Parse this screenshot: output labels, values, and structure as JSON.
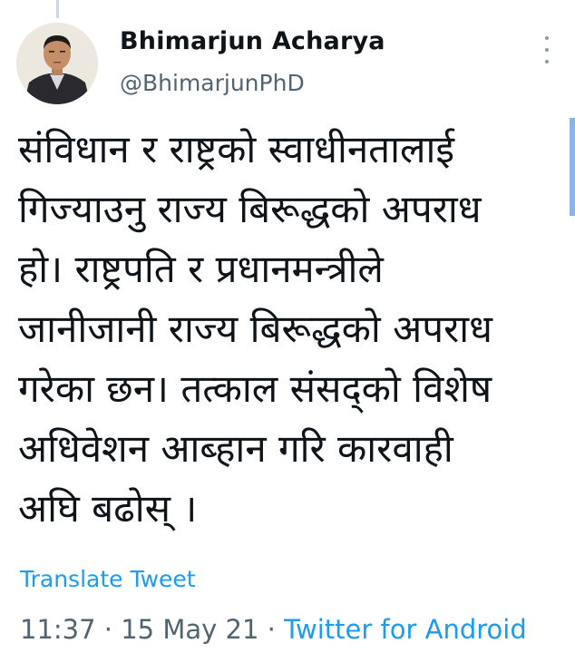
{
  "author": {
    "name": "Bhimarjun Acharya",
    "handle": "@BhimarjunPhD",
    "avatar_icon": "profile-photo"
  },
  "tweet": {
    "lines": [
      "संविधान र राष्ट्रको स्वाधीनतालाई",
      "गिज्याउनु राज्य बिरूद्धको अपराध",
      "हो। राष्ट्रपति र प्रधानमन्त्रीले",
      "जानीजानी राज्य बिरूद्धको अपराध",
      "गरेका छन। तत्काल संसद्को विशेष",
      "अधिवेशन आब्हान गरि कारवाही",
      "अघि बढोस् ।"
    ]
  },
  "translate_label": "Translate Tweet",
  "meta": {
    "time": "11:37",
    "separator": " · ",
    "date": "15 May 21",
    "source": "Twitter for Android"
  },
  "colors": {
    "link": "#1d9bf0",
    "secondary": "#536471"
  }
}
